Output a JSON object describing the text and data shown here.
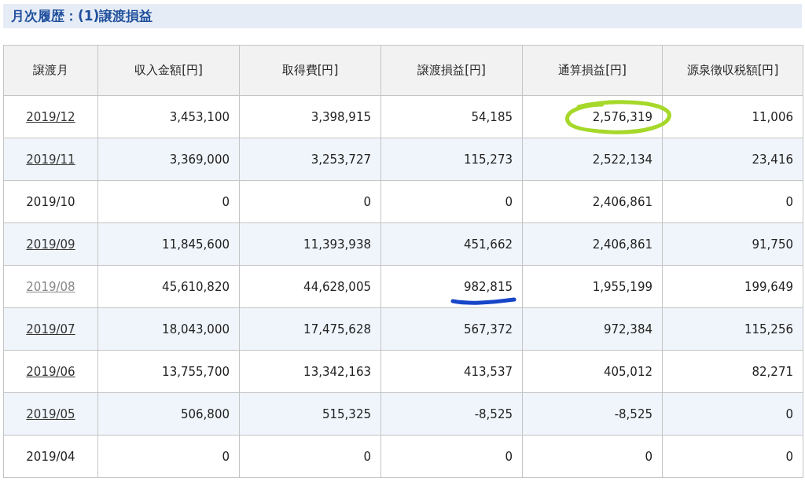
{
  "section_title": "月次履歴：(1)譲渡損益",
  "table": {
    "columns": [
      "譲渡月",
      "収入金額[円]",
      "取得費[円]",
      "譲渡損益[円]",
      "通算損益[円]",
      "源泉徴収税額[円]"
    ],
    "rows": [
      {
        "cells": [
          {
            "text": "2019/12",
            "link": true,
            "visited": false
          },
          {
            "text": "3,453,100"
          },
          {
            "text": "3,398,915"
          },
          {
            "text": "54,185"
          },
          {
            "text": "2,576,319",
            "kind": "circled"
          },
          {
            "text": "11,006"
          }
        ]
      },
      {
        "cells": [
          {
            "text": "2019/11",
            "link": true,
            "visited": false
          },
          {
            "text": "3,369,000"
          },
          {
            "text": "3,253,727"
          },
          {
            "text": "115,273"
          },
          {
            "text": "2,522,134"
          },
          {
            "text": "23,416"
          }
        ]
      },
      {
        "cells": [
          {
            "text": "2019/10",
            "link": false
          },
          {
            "text": "0"
          },
          {
            "text": "0"
          },
          {
            "text": "0"
          },
          {
            "text": "2,406,861"
          },
          {
            "text": "0"
          }
        ]
      },
      {
        "cells": [
          {
            "text": "2019/09",
            "link": true,
            "visited": false
          },
          {
            "text": "11,845,600"
          },
          {
            "text": "11,393,938"
          },
          {
            "text": "451,662"
          },
          {
            "text": "2,406,861"
          },
          {
            "text": "91,750"
          }
        ]
      },
      {
        "cells": [
          {
            "text": "2019/08",
            "link": true,
            "visited": true
          },
          {
            "text": "45,610,820"
          },
          {
            "text": "44,628,005"
          },
          {
            "text": "982,815",
            "kind": "underlined"
          },
          {
            "text": "1,955,199"
          },
          {
            "text": "199,649"
          }
        ]
      },
      {
        "cells": [
          {
            "text": "2019/07",
            "link": true,
            "visited": false
          },
          {
            "text": "18,043,000"
          },
          {
            "text": "17,475,628"
          },
          {
            "text": "567,372"
          },
          {
            "text": "972,384"
          },
          {
            "text": "115,256"
          }
        ]
      },
      {
        "cells": [
          {
            "text": "2019/06",
            "link": true,
            "visited": false
          },
          {
            "text": "13,755,700"
          },
          {
            "text": "13,342,163"
          },
          {
            "text": "413,537"
          },
          {
            "text": "405,012"
          },
          {
            "text": "82,271"
          }
        ]
      },
      {
        "cells": [
          {
            "text": "2019/05",
            "link": true,
            "visited": false
          },
          {
            "text": "506,800"
          },
          {
            "text": "515,325"
          },
          {
            "text": "-8,525"
          },
          {
            "text": "-8,525"
          },
          {
            "text": "0"
          }
        ]
      },
      {
        "cells": [
          {
            "text": "2019/04",
            "link": false
          },
          {
            "text": "0"
          },
          {
            "text": "0"
          },
          {
            "text": "0"
          },
          {
            "text": "0"
          },
          {
            "text": "0"
          }
        ]
      }
    ]
  }
}
